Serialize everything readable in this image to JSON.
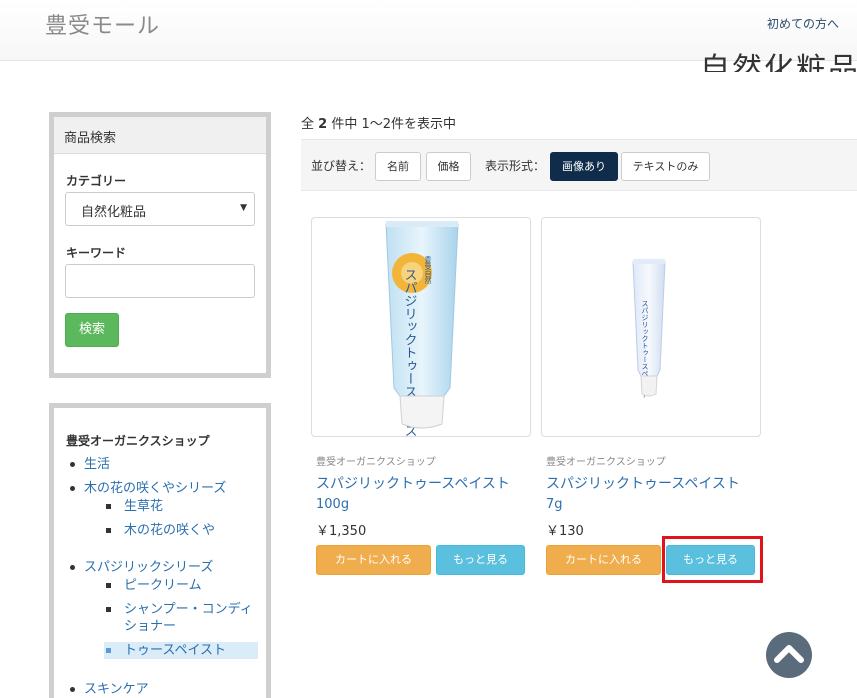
{
  "header": {
    "site_title": "豊受モール",
    "first_time_link": "初めての方へ",
    "page_heading": "自然化粧品"
  },
  "search_panel": {
    "heading": "商品検索",
    "category_label": "カテゴリー",
    "category_selected": "自然化粧品",
    "keyword_label": "キーワード",
    "keyword_value": "",
    "search_button": "検索"
  },
  "category_panel": {
    "shop_name": "豊受オーガニクスショップ",
    "items": [
      {
        "label": "生活"
      },
      {
        "label": "木の花の咲くやシリーズ",
        "children": [
          {
            "label": "生草花"
          },
          {
            "label": "木の花の咲くや"
          }
        ]
      },
      {
        "label": "スパジリックシリーズ",
        "children": [
          {
            "label": "ピークリーム"
          },
          {
            "label": "シャンプー・コンディショナー"
          },
          {
            "label": "トゥースペイスト",
            "active": true
          }
        ]
      },
      {
        "label": "スキンケア"
      }
    ]
  },
  "results": {
    "prefix": "全 ",
    "total": "2",
    "suffix": " 件中 1～2件を表示中"
  },
  "toolbar": {
    "sort_label": "並び替え：",
    "sort_name": "名前",
    "sort_price": "価格",
    "view_label": "表示形式：",
    "view_image": "画像あり",
    "view_text": "テキストのみ"
  },
  "products": [
    {
      "shop": "豊受オーガニクスショップ",
      "name": "スパジリックトゥースペイスト",
      "size": "100g",
      "price": "￥1,350",
      "cart_button": "カートに入れる",
      "more_button": "もっと見る"
    },
    {
      "shop": "豊受オーガニクスショップ",
      "name": "スパジリックトゥースペイスト",
      "size": "7g",
      "price": "￥130",
      "cart_button": "カートに入れる",
      "more_button": "もっと見る"
    }
  ],
  "tube_labels": {
    "large_text": "スパジリックトゥースペイスト",
    "large_brand": "豊受自然",
    "small_text": "スパジリックトゥースペイスト"
  },
  "colors": {
    "link": "#2a6fb0",
    "success": "#5cb85c",
    "warning": "#f0ad4e",
    "info": "#5bc0de",
    "active_view": "#0f2d4a",
    "highlight": "#e0121b"
  },
  "icons": {
    "scroll_top": "chevron-up-icon",
    "select_caret": "caret-down-icon"
  }
}
